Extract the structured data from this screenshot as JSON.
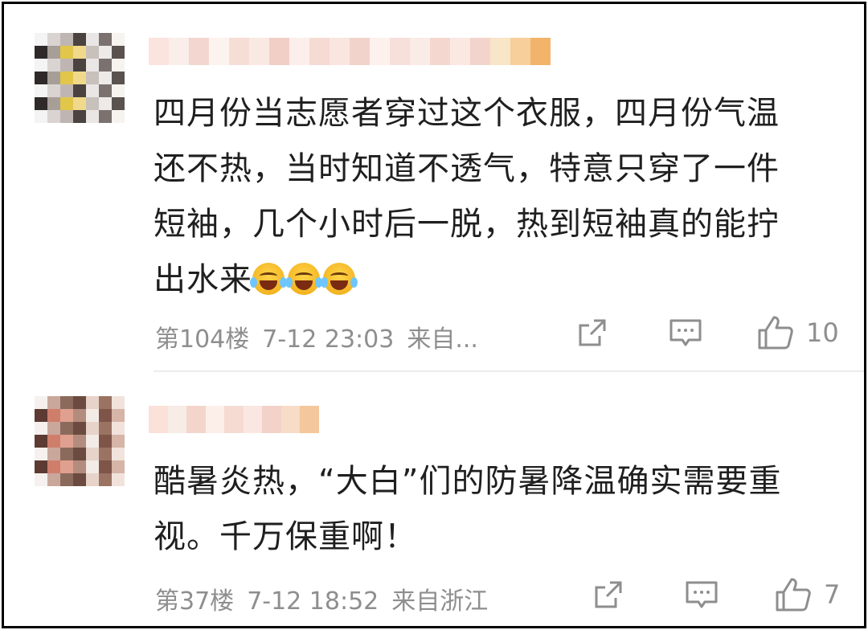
{
  "comments": [
    {
      "text_lines": [
        "四月份当志愿者穿过这个衣服，四月份气温",
        "还不热，当时知道不透气，特意只穿了一件",
        "短袖，几个小时后一脱，热到短袖真的能拧",
        "出水来"
      ],
      "emoji": [
        "laugh-cry-emoji",
        "laugh-cry-emoji",
        "laugh-cry-emoji"
      ],
      "floor": "第104楼",
      "time": "7-12 23:03",
      "source": "来自...",
      "likes": "10"
    },
    {
      "text_lines": [
        "酷暑炎热，“大白”们的防暑降温确实需要重",
        "视。千万保重啊！"
      ],
      "floor": "第37楼",
      "time": "7-12 18:52",
      "source": "来自浙江",
      "likes": "7"
    }
  ],
  "icons": {
    "share": "share-icon",
    "reply": "comment-icon",
    "like": "thumbs-up-icon"
  },
  "colors": {
    "meta_gray": "#8e8e8e",
    "text": "#1f1f1f",
    "emoji": "#f2b01e"
  }
}
